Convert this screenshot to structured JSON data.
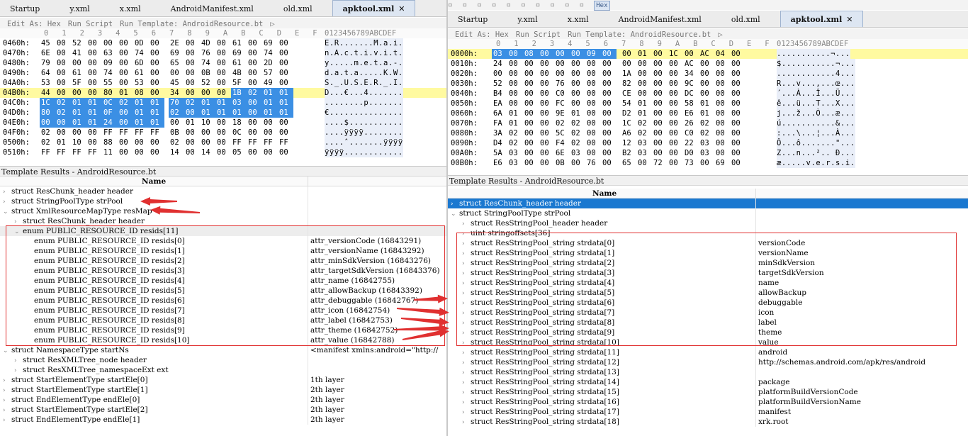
{
  "left": {
    "tabs": [
      "Startup",
      "y.xml",
      "x.xml",
      "AndroidManifest.xml",
      "old.xml",
      "apktool.xml"
    ],
    "active_tab_index": 5,
    "toolbar": {
      "edit_as": "Edit As: Hex",
      "run_script": "Run Script",
      "run_template": "Run Template: AndroidResource.bt",
      "play": "▷"
    },
    "column_header": "0   1   2   3   4   5   6   7   8   9   A   B   C   D   E   F",
    "ascii_header": "0123456789ABCDEF",
    "hex_rows": [
      {
        "addr": "0460h:",
        "bytes": [
          "45",
          "00",
          "52",
          "00",
          "00",
          "00",
          "0D",
          "00",
          "2E",
          "00",
          "4D",
          "00",
          "61",
          "00",
          "69",
          "00"
        ],
        "ascii": "E.R.......M.a.i."
      },
      {
        "addr": "0470h:",
        "bytes": [
          "6E",
          "00",
          "41",
          "00",
          "63",
          "00",
          "74",
          "00",
          "69",
          "00",
          "76",
          "00",
          "69",
          "00",
          "74",
          "00"
        ],
        "ascii": "n.A.c.t.i.v.i.t."
      },
      {
        "addr": "0480h:",
        "bytes": [
          "79",
          "00",
          "00",
          "00",
          "09",
          "00",
          "6D",
          "00",
          "65",
          "00",
          "74",
          "00",
          "61",
          "00",
          "2D",
          "00"
        ],
        "ascii": "y.....m.e.t.a.-."
      },
      {
        "addr": "0490h:",
        "bytes": [
          "64",
          "00",
          "61",
          "00",
          "74",
          "00",
          "61",
          "00",
          "00",
          "00",
          "0B",
          "00",
          "4B",
          "00",
          "57",
          "00"
        ],
        "ascii": "d.a.t.a.....K.W."
      },
      {
        "addr": "04A0h:",
        "bytes": [
          "53",
          "00",
          "5F",
          "00",
          "55",
          "00",
          "53",
          "00",
          "45",
          "00",
          "52",
          "00",
          "5F",
          "00",
          "49",
          "00"
        ],
        "ascii": "S._.U.S.E.R._.I."
      },
      {
        "addr": "04B0h:",
        "bytes": [
          "44",
          "00",
          "00",
          "00",
          "80",
          "01",
          "08",
          "00",
          "34",
          "00",
          "00",
          "00",
          "1B",
          "02",
          "01",
          "01"
        ],
        "ascii": "D...€...4.......",
        "sel_from": 12,
        "mark": true
      },
      {
        "addr": "04C0h:",
        "bytes": [
          "1C",
          "02",
          "01",
          "01",
          "0C",
          "02",
          "01",
          "01",
          "70",
          "02",
          "01",
          "01",
          "03",
          "00",
          "01",
          "01"
        ],
        "ascii": "........p.......",
        "sel_from": 0
      },
      {
        "addr": "04D0h:",
        "bytes": [
          "80",
          "02",
          "01",
          "01",
          "0F",
          "00",
          "01",
          "01",
          "02",
          "00",
          "01",
          "01",
          "01",
          "00",
          "01",
          "01"
        ],
        "ascii": "€...............",
        "sel_from": 0
      },
      {
        "addr": "04E0h:",
        "bytes": [
          "00",
          "00",
          "01",
          "01",
          "24",
          "00",
          "01",
          "01",
          "00",
          "01",
          "10",
          "00",
          "18",
          "00",
          "00",
          "00"
        ],
        "ascii": "....$...........",
        "sel_to": 8
      },
      {
        "addr": "04F0h:",
        "bytes": [
          "02",
          "00",
          "00",
          "00",
          "FF",
          "FF",
          "FF",
          "FF",
          "0B",
          "00",
          "00",
          "00",
          "0C",
          "00",
          "00",
          "00"
        ],
        "ascii": "....ÿÿÿÿ........"
      },
      {
        "addr": "0500h:",
        "bytes": [
          "02",
          "01",
          "10",
          "00",
          "88",
          "00",
          "00",
          "00",
          "02",
          "00",
          "00",
          "00",
          "FF",
          "FF",
          "FF",
          "FF"
        ],
        "ascii": "....ˆ.......ÿÿÿÿ"
      },
      {
        "addr": "0510h:",
        "bytes": [
          "FF",
          "FF",
          "FF",
          "FF",
          "11",
          "00",
          "00",
          "00",
          "14",
          "00",
          "14",
          "00",
          "05",
          "00",
          "00",
          "00"
        ],
        "ascii": "ÿÿÿÿ............"
      }
    ],
    "template_title": "Template Results - AndroidResource.bt",
    "name_header": "Name",
    "rows": [
      {
        "indent": 0,
        "tw": ">",
        "name": "struct ResChunk_header header",
        "value": ""
      },
      {
        "indent": 0,
        "tw": ">",
        "name": "struct StringPoolType strPool",
        "value": ""
      },
      {
        "indent": 0,
        "tw": "v",
        "name": "struct XmlResourceMapType resMap",
        "value": ""
      },
      {
        "indent": 1,
        "tw": ">",
        "name": "struct ResChunk_header header",
        "value": ""
      },
      {
        "indent": 1,
        "tw": "v",
        "name": "enum PUBLIC_RESOURCE_ID resids[11]",
        "value": "",
        "gray": true
      },
      {
        "indent": 2,
        "tw": "",
        "name": "enum PUBLIC_RESOURCE_ID resids[0]",
        "value": "attr_versionCode (16843291)"
      },
      {
        "indent": 2,
        "tw": "",
        "name": "enum PUBLIC_RESOURCE_ID resids[1]",
        "value": "attr_versionName (16843292)"
      },
      {
        "indent": 2,
        "tw": "",
        "name": "enum PUBLIC_RESOURCE_ID resids[2]",
        "value": "attr_minSdkVersion (16843276)"
      },
      {
        "indent": 2,
        "tw": "",
        "name": "enum PUBLIC_RESOURCE_ID resids[3]",
        "value": "attr_targetSdkVersion (16843376)"
      },
      {
        "indent": 2,
        "tw": "",
        "name": "enum PUBLIC_RESOURCE_ID resids[4]",
        "value": "attr_name (16842755)"
      },
      {
        "indent": 2,
        "tw": "",
        "name": "enum PUBLIC_RESOURCE_ID resids[5]",
        "value": "attr_allowBackup (16843392)"
      },
      {
        "indent": 2,
        "tw": "",
        "name": "enum PUBLIC_RESOURCE_ID resids[6]",
        "value": "attr_debuggable (16842767)"
      },
      {
        "indent": 2,
        "tw": "",
        "name": "enum PUBLIC_RESOURCE_ID resids[7]",
        "value": "attr_icon (16842754)"
      },
      {
        "indent": 2,
        "tw": "",
        "name": "enum PUBLIC_RESOURCE_ID resids[8]",
        "value": "attr_label (16842753)"
      },
      {
        "indent": 2,
        "tw": "",
        "name": "enum PUBLIC_RESOURCE_ID resids[9]",
        "value": "attr_theme (16842752)"
      },
      {
        "indent": 2,
        "tw": "",
        "name": "enum PUBLIC_RESOURCE_ID resids[10]",
        "value": "attr_value (16842788)"
      },
      {
        "indent": 0,
        "tw": "v",
        "name": "struct NamespaceType startNs",
        "value": "<manifest xmlns:android=\"http://"
      },
      {
        "indent": 1,
        "tw": ">",
        "name": "struct ResXMLTree_node header",
        "value": ""
      },
      {
        "indent": 1,
        "tw": ">",
        "name": "struct ResXMLTree_namespaceExt ext",
        "value": ""
      },
      {
        "indent": 0,
        "tw": ">",
        "name": "struct StartElementType startEle[0]",
        "value": "1th layer"
      },
      {
        "indent": 0,
        "tw": ">",
        "name": "struct StartElementType startEle[1]",
        "value": "2th layer"
      },
      {
        "indent": 0,
        "tw": ">",
        "name": "struct EndElementType endEle[0]",
        "value": "2th layer"
      },
      {
        "indent": 0,
        "tw": ">",
        "name": "struct StartElementType startEle[2]",
        "value": "2th layer"
      },
      {
        "indent": 0,
        "tw": ">",
        "name": "struct EndElementType endEle[1]",
        "value": "2th layer"
      }
    ]
  },
  "right": {
    "hex_button": "Hex",
    "tabs": [
      "Startup",
      "y.xml",
      "x.xml",
      "AndroidManifest.xml",
      "old.xml",
      "apktool.xml"
    ],
    "active_tab_index": 5,
    "toolbar": {
      "edit_as": "Edit As: Hex",
      "run_script": "Run Script",
      "run_template": "Run Template: AndroidResource.bt",
      "play": "▷"
    },
    "column_header": "0   1   2   3   4   5   6   7   8   9   A   B   C   D   E   F",
    "ascii_header": "0123456789ABCDEF",
    "hex_rows": [
      {
        "addr": "0000h:",
        "bytes": [
          "03",
          "00",
          "08",
          "00",
          "00",
          "00",
          "09",
          "00",
          "00",
          "01",
          "00",
          "1C",
          "00",
          "AC",
          "04",
          "00"
        ],
        "ascii": "...........¬...",
        "sel_to": 8,
        "mark": true
      },
      {
        "addr": "0010h:",
        "bytes": [
          "24",
          "00",
          "00",
          "00",
          "00",
          "00",
          "00",
          "00",
          "00",
          "00",
          "00",
          "00",
          "AC",
          "00",
          "00",
          "00"
        ],
        "ascii": "$...........¬..."
      },
      {
        "addr": "0020h:",
        "bytes": [
          "00",
          "00",
          "00",
          "00",
          "00",
          "00",
          "00",
          "00",
          "1A",
          "00",
          "00",
          "00",
          "34",
          "00",
          "00",
          "00"
        ],
        "ascii": "............4..."
      },
      {
        "addr": "0030h:",
        "bytes": [
          "52",
          "00",
          "00",
          "00",
          "76",
          "00",
          "00",
          "00",
          "82",
          "00",
          "00",
          "00",
          "9C",
          "00",
          "00",
          "00"
        ],
        "ascii": "R...v...‚...œ..."
      },
      {
        "addr": "0040h:",
        "bytes": [
          "B4",
          "00",
          "00",
          "00",
          "C0",
          "00",
          "00",
          "00",
          "CE",
          "00",
          "00",
          "00",
          "DC",
          "00",
          "00",
          "00"
        ],
        "ascii": "´...À...Î...Ü..."
      },
      {
        "addr": "0050h:",
        "bytes": [
          "EA",
          "00",
          "00",
          "00",
          "FC",
          "00",
          "00",
          "00",
          "54",
          "01",
          "00",
          "00",
          "58",
          "01",
          "00",
          "00"
        ],
        "ascii": "ê...ü...T...X..."
      },
      {
        "addr": "0060h:",
        "bytes": [
          "6A",
          "01",
          "00",
          "00",
          "9E",
          "01",
          "00",
          "00",
          "D2",
          "01",
          "00",
          "00",
          "E6",
          "01",
          "00",
          "00"
        ],
        "ascii": "j...ž...Ò...æ..."
      },
      {
        "addr": "0070h:",
        "bytes": [
          "FA",
          "01",
          "00",
          "00",
          "02",
          "02",
          "00",
          "00",
          "1C",
          "02",
          "00",
          "00",
          "26",
          "02",
          "00",
          "00"
        ],
        "ascii": "ú...........&..."
      },
      {
        "addr": "0080h:",
        "bytes": [
          "3A",
          "02",
          "00",
          "00",
          "5C",
          "02",
          "00",
          "00",
          "A6",
          "02",
          "00",
          "00",
          "C0",
          "02",
          "00",
          "00"
        ],
        "ascii": ":...\\...¦...À..."
      },
      {
        "addr": "0090h:",
        "bytes": [
          "D4",
          "02",
          "00",
          "00",
          "F4",
          "02",
          "00",
          "00",
          "12",
          "03",
          "00",
          "00",
          "22",
          "03",
          "00",
          "00"
        ],
        "ascii": "Ô...ô.......\"..."
      },
      {
        "addr": "00A0h:",
        "bytes": [
          "5A",
          "03",
          "00",
          "00",
          "6E",
          "03",
          "00",
          "00",
          "B2",
          "03",
          "00",
          "00",
          "D0",
          "03",
          "00",
          "00"
        ],
        "ascii": "Z...n...².. Ð..."
      },
      {
        "addr": "00B0h:",
        "bytes": [
          "E6",
          "03",
          "00",
          "00",
          "0B",
          "00",
          "76",
          "00",
          "65",
          "00",
          "72",
          "00",
          "73",
          "00",
          "69",
          "00"
        ],
        "ascii": "æ.....v.e.r.s.i."
      }
    ],
    "template_title": "Template Results - AndroidResource.bt",
    "name_header": "Name",
    "rows": [
      {
        "indent": 0,
        "tw": ">",
        "name": "struct ResChunk_header header",
        "value": "",
        "highlight": true
      },
      {
        "indent": 0,
        "tw": "v",
        "name": "struct StringPoolType strPool",
        "value": ""
      },
      {
        "indent": 1,
        "tw": ">",
        "name": "struct ResStringPool_header header",
        "value": ""
      },
      {
        "indent": 1,
        "tw": ">",
        "name": "uint stringoffsets[36]",
        "value": ""
      },
      {
        "indent": 1,
        "tw": ">",
        "name": "struct ResStringPool_string strdata[0]",
        "value": "versionCode"
      },
      {
        "indent": 1,
        "tw": ">",
        "name": "struct ResStringPool_string strdata[1]",
        "value": "versionName"
      },
      {
        "indent": 1,
        "tw": ">",
        "name": "struct ResStringPool_string strdata[2]",
        "value": "minSdkVersion"
      },
      {
        "indent": 1,
        "tw": ">",
        "name": "struct ResStringPool_string strdata[3]",
        "value": "targetSdkVersion"
      },
      {
        "indent": 1,
        "tw": ">",
        "name": "struct ResStringPool_string strdata[4]",
        "value": "name"
      },
      {
        "indent": 1,
        "tw": ">",
        "name": "struct ResStringPool_string strdata[5]",
        "value": "allowBackup"
      },
      {
        "indent": 1,
        "tw": ">",
        "name": "struct ResStringPool_string strdata[6]",
        "value": "debuggable"
      },
      {
        "indent": 1,
        "tw": ">",
        "name": "struct ResStringPool_string strdata[7]",
        "value": "icon"
      },
      {
        "indent": 1,
        "tw": ">",
        "name": "struct ResStringPool_string strdata[8]",
        "value": "label"
      },
      {
        "indent": 1,
        "tw": ">",
        "name": "struct ResStringPool_string strdata[9]",
        "value": "theme"
      },
      {
        "indent": 1,
        "tw": ">",
        "name": "struct ResStringPool_string strdata[10]",
        "value": "value"
      },
      {
        "indent": 1,
        "tw": ">",
        "name": "struct ResStringPool_string strdata[11]",
        "value": "android"
      },
      {
        "indent": 1,
        "tw": ">",
        "name": "struct ResStringPool_string strdata[12]",
        "value": "http://schemas.android.com/apk/res/android"
      },
      {
        "indent": 1,
        "tw": ">",
        "name": "struct ResStringPool_string strdata[13]",
        "value": ""
      },
      {
        "indent": 1,
        "tw": ">",
        "name": "struct ResStringPool_string strdata[14]",
        "value": "package"
      },
      {
        "indent": 1,
        "tw": ">",
        "name": "struct ResStringPool_string strdata[15]",
        "value": "platformBuildVersionCode"
      },
      {
        "indent": 1,
        "tw": ">",
        "name": "struct ResStringPool_string strdata[16]",
        "value": "platformBuildVersionName"
      },
      {
        "indent": 1,
        "tw": ">",
        "name": "struct ResStringPool_string strdata[17]",
        "value": "manifest"
      },
      {
        "indent": 1,
        "tw": ">",
        "name": "struct ResStringPool_string strdata[18]",
        "value": "xrk.root"
      }
    ]
  },
  "colors": {
    "selection": "#3b8fe4",
    "highlight_row": "#1a78d0",
    "annotation_red": "#e03030",
    "mark_yellow": "#fffaa0"
  }
}
